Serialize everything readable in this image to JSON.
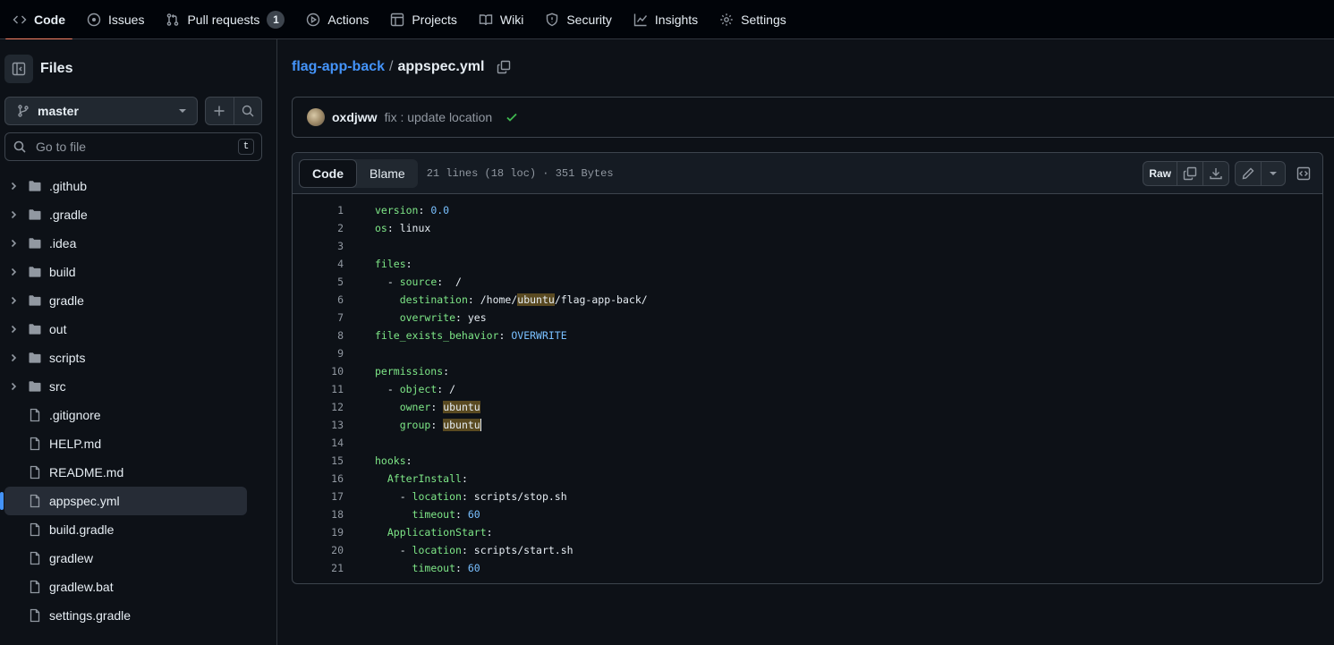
{
  "nav": {
    "tabs": [
      {
        "label": "Code",
        "icon": "code-icon"
      },
      {
        "label": "Issues",
        "icon": "issue-icon"
      },
      {
        "label": "Pull requests",
        "icon": "pull-request-icon",
        "count": "1"
      },
      {
        "label": "Actions",
        "icon": "play-icon"
      },
      {
        "label": "Projects",
        "icon": "table-icon"
      },
      {
        "label": "Wiki",
        "icon": "book-icon"
      },
      {
        "label": "Security",
        "icon": "shield-icon"
      },
      {
        "label": "Insights",
        "icon": "graph-icon"
      },
      {
        "label": "Settings",
        "icon": "gear-icon"
      }
    ],
    "active": "Code"
  },
  "sidebar": {
    "title": "Files",
    "branch": "master",
    "search_placeholder": "Go to file",
    "search_shortcut": "t",
    "items": [
      {
        "name": ".github",
        "type": "folder"
      },
      {
        "name": ".gradle",
        "type": "folder"
      },
      {
        "name": ".idea",
        "type": "folder"
      },
      {
        "name": "build",
        "type": "folder"
      },
      {
        "name": "gradle",
        "type": "folder"
      },
      {
        "name": "out",
        "type": "folder"
      },
      {
        "name": "scripts",
        "type": "folder"
      },
      {
        "name": "src",
        "type": "folder"
      },
      {
        "name": ".gitignore",
        "type": "file"
      },
      {
        "name": "HELP.md",
        "type": "file"
      },
      {
        "name": "README.md",
        "type": "file"
      },
      {
        "name": "appspec.yml",
        "type": "file",
        "selected": true
      },
      {
        "name": "build.gradle",
        "type": "file"
      },
      {
        "name": "gradlew",
        "type": "file"
      },
      {
        "name": "gradlew.bat",
        "type": "file"
      },
      {
        "name": "settings.gradle",
        "type": "file"
      }
    ]
  },
  "breadcrumb": {
    "repo": "flag-app-back",
    "separator": "/",
    "file": "appspec.yml"
  },
  "commit": {
    "author": "oxdjww",
    "message": "fix : update location"
  },
  "viewer": {
    "tab_code": "Code",
    "tab_blame": "Blame",
    "meta": "21 lines (18 loc) · 351 Bytes",
    "raw": "Raw"
  },
  "code_lines": [
    "version: 0.0",
    "os: linux",
    "",
    "files:",
    "  - source:  /",
    "    destination: /home/ubuntu/flag-app-back/",
    "    overwrite: yes",
    "file_exists_behavior: OVERWRITE",
    "",
    "permissions:",
    "  - object: /",
    "    owner: ubuntu",
    "    group: ubuntu",
    "",
    "hooks:",
    "  AfterInstall:",
    "    - location: scripts/stop.sh",
    "      timeout: 60",
    "  ApplicationStart:",
    "    - location: scripts/start.sh",
    "      timeout: 60"
  ],
  "colors": {
    "background": "#0d1117",
    "nav_bg": "#010409",
    "accent": "#4493f8",
    "active_tab_underline": "#f78166",
    "yaml_key": "#7ee787",
    "yaml_constant": "#79c0ff",
    "search_highlight": "#5a4a21",
    "success": "#3fb950"
  }
}
